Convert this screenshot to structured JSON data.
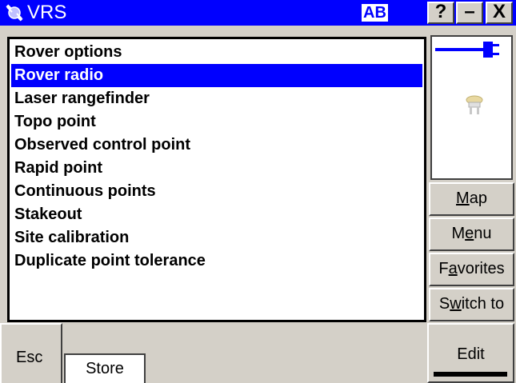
{
  "window": {
    "title": "VRS",
    "input_mode": "AB",
    "help_label": "?",
    "minimize_label": "–",
    "close_label": "X",
    "accent_color": "#0000ff"
  },
  "list": {
    "items": [
      "Rover options",
      "Rover radio",
      "Laser rangefinder",
      "Topo point",
      "Observed control point",
      "Rapid point",
      "Continuous points",
      "Stakeout",
      "Site calibration",
      "Duplicate point tolerance"
    ],
    "selected": "Rover radio"
  },
  "status": {
    "icons": [
      "power-connector-icon",
      "gps-receiver-icon"
    ]
  },
  "side_buttons": {
    "map": {
      "before": "",
      "mnemonic": "M",
      "after": "ap"
    },
    "menu": {
      "before": "M",
      "mnemonic": "e",
      "after": "nu"
    },
    "favorites": {
      "before": "F",
      "mnemonic": "a",
      "after": "vorites"
    },
    "switch_to": {
      "before": "S",
      "mnemonic": "w",
      "after": "itch to"
    }
  },
  "softkeys": {
    "esc": "Esc",
    "store": "Store",
    "edit": "Edit"
  }
}
